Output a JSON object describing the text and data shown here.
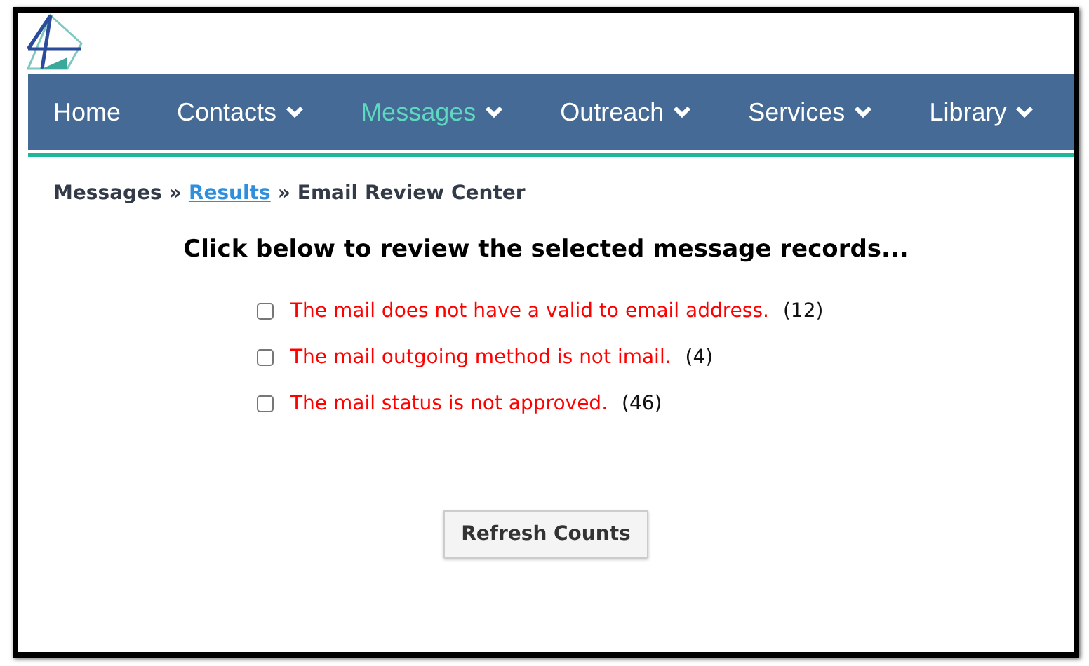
{
  "nav": [
    {
      "label": "Home",
      "dropdown": false,
      "selected": false
    },
    {
      "label": "Contacts",
      "dropdown": true,
      "selected": false
    },
    {
      "label": "Messages",
      "dropdown": true,
      "selected": true
    },
    {
      "label": "Outreach",
      "dropdown": true,
      "selected": false
    },
    {
      "label": "Services",
      "dropdown": true,
      "selected": false
    },
    {
      "label": "Library",
      "dropdown": true,
      "selected": false
    }
  ],
  "breadcrumb": [
    {
      "label": "Messages",
      "link": false
    },
    {
      "label": "Results",
      "link": true
    },
    {
      "label": "Email Review Center",
      "link": false
    }
  ],
  "breadcrumb_separator": "»",
  "heading": "Click below to review the selected message records...",
  "options": [
    {
      "label": "The mail does not have a valid to email address.",
      "count": "(12)",
      "checked": false
    },
    {
      "label": "The mail outgoing method is not imail.",
      "count": "(4)",
      "checked": false
    },
    {
      "label": "The mail status is not approved.",
      "count": "(46)",
      "checked": false
    }
  ],
  "button": "Refresh Counts"
}
